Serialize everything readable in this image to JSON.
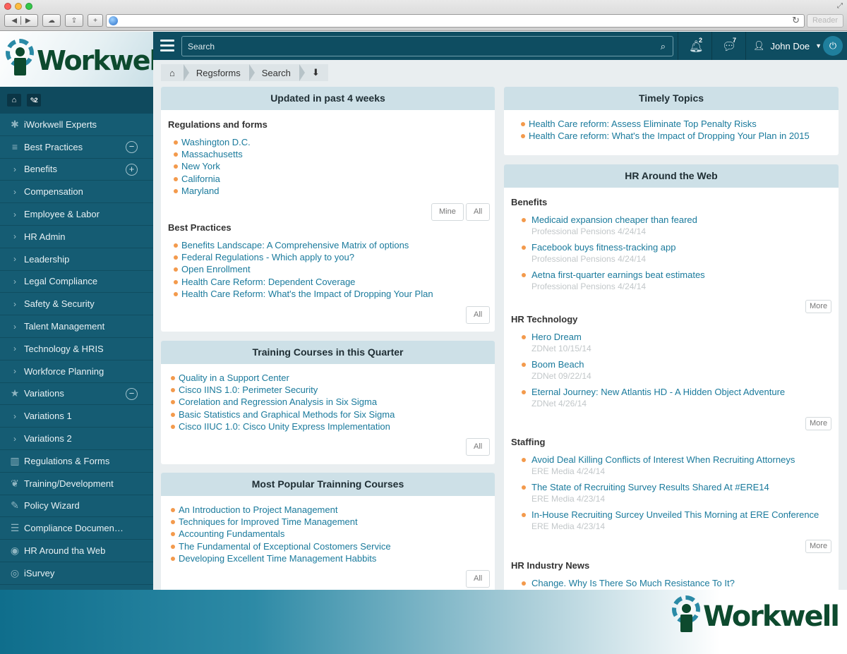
{
  "browser": {
    "reader_label": "Reader"
  },
  "brand": {
    "logo_text": "Workwell"
  },
  "sidebar": {
    "quick_badge": "2",
    "items": [
      {
        "label": "iWorkwell Experts",
        "icon": "asterisk-icon"
      },
      {
        "label": "Best Practices",
        "icon": "stack-icon",
        "toggle": "−"
      },
      {
        "label": "Benefits",
        "sub": true,
        "toggle": "+"
      },
      {
        "label": "Compensation",
        "sub": true
      },
      {
        "label": "Employee & Labor",
        "sub": true
      },
      {
        "label": "HR Admin",
        "sub": true
      },
      {
        "label": "Leadership",
        "sub": true
      },
      {
        "label": "Legal Compliance",
        "sub": true
      },
      {
        "label": "Safety & Security",
        "sub": true
      },
      {
        "label": "Talent Management",
        "sub": true
      },
      {
        "label": "Technology & HRIS",
        "sub": true
      },
      {
        "label": "Workforce Planning",
        "sub": true
      },
      {
        "label": "Variations",
        "icon": "star-icon",
        "toggle": "−"
      },
      {
        "label": "Variations 1",
        "sub": true
      },
      {
        "label": "Variations 2",
        "sub": true
      },
      {
        "label": "Regulations & Forms",
        "icon": "bar-chart-icon"
      },
      {
        "label": "Training/Development",
        "icon": "leaf-icon"
      },
      {
        "label": "Policy Wizard",
        "icon": "edit-icon"
      },
      {
        "label": "Compliance Documen…",
        "icon": "list-icon"
      },
      {
        "label": "HR Around tha Web",
        "icon": "rss-icon"
      },
      {
        "label": "iSurvey",
        "icon": "eye-icon"
      }
    ]
  },
  "topbar": {
    "search_placeholder": "Search",
    "notifications_count": "2",
    "messages_count": "7",
    "user_name": "John Doe"
  },
  "breadcrumb": [
    "Regsforms",
    "Search"
  ],
  "updated": {
    "title": "Updated in past 4 weeks",
    "reg_title": "Regulations and forms",
    "reg_items": [
      "Washington D.C.",
      "Massachusetts",
      "New York",
      "California",
      "Maryland"
    ],
    "mine_label": "Mine",
    "all_label": "All",
    "bp_title": "Best Practices",
    "bp_items": [
      "Benefits Landscape: A Comprehensive Matrix of options",
      "Federal Regulations - Which apply to you?",
      "Open Enrollment",
      "Health Care Reform: Dependent Coverage",
      "Health Care Reform: What's the Impact of Dropping Your Plan"
    ]
  },
  "training": {
    "title": "Training Courses in this Quarter",
    "items": [
      "Quality in a Support Center",
      "Cisco IINS 1.0: Perimeter Security",
      "Corelation and Regression Analysis in Six Sigma",
      "Basic Statistics and Graphical Methods for Six Sigma",
      "Cisco IIUC 1.0: Cisco Unity Express Implementation"
    ],
    "all_label": "All"
  },
  "popular": {
    "title": "Most Popular Trainning Courses",
    "items": [
      "An Introduction to Project Management",
      "Techniques for Improved Time Management",
      "Accounting Fundamentals",
      "The Fundamental of Exceptional Costomers Service",
      "Developing Excellent Time Management Habbits"
    ],
    "all_label": "All"
  },
  "timely": {
    "title": "Timely Topics",
    "items": [
      "Health Care reform: Assess   Eliminate Top Penalty Risks",
      "Health Care reform: What's the Impact of Dropping Your Plan in 2015"
    ]
  },
  "hrweb": {
    "title": "HR Around the Web",
    "more_label": "More",
    "sections": [
      {
        "title": "Benefits",
        "items": [
          {
            "t": "Medicaid expansion cheaper than feared",
            "s": "Professional Pensions 4/24/14"
          },
          {
            "t": "Facebook buys fitness-tracking app",
            "s": "Professional Pensions 4/24/14"
          },
          {
            "t": "Aetna first-quarter earnings beat estimates",
            "s": "Professional Pensions 4/24/14"
          }
        ]
      },
      {
        "title": "HR Technology",
        "items": [
          {
            "t": "Hero Dream",
            "s": "ZDNet 10/15/14"
          },
          {
            "t": "Boom Beach",
            "s": "ZDNet 09/22/14"
          },
          {
            "t": "Eternal Journey: New Atlantis HD - A Hidden Object Adventure",
            "s": "ZDNet 4/26/14"
          }
        ]
      },
      {
        "title": "Staffing",
        "items": [
          {
            "t": "Avoid Deal Killing Conflicts of Interest When Recruiting Attorneys",
            "s": "ERE Media 4/24/14"
          },
          {
            "t": "The State of Recruiting Survey Results Shared At #ERE14",
            "s": "ERE Media 4/23/14"
          },
          {
            "t": "In-House Recruiting Surcey Unveiled This Morning at ERE Conference",
            "s": "ERE Media 4/23/14"
          }
        ]
      },
      {
        "title": "HR Industry News",
        "items": [
          {
            "t": "Change. Why Is There So Much Resistance To It?",
            "s": ""
          }
        ]
      }
    ]
  }
}
